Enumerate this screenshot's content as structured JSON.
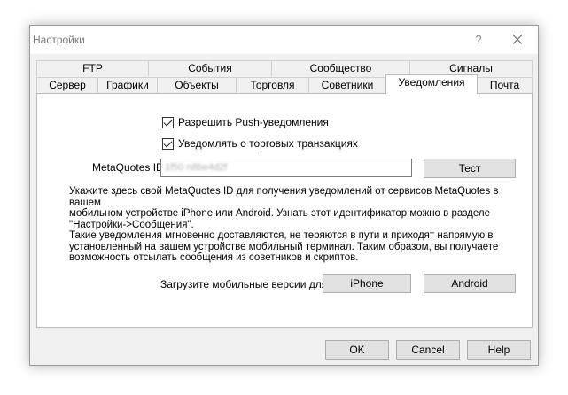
{
  "window": {
    "title": "Настройки",
    "help_glyph": "?"
  },
  "tabs_row1": [
    "FTP",
    "События",
    "Сообщество",
    "Сигналы"
  ],
  "tabs_row2": [
    "Сервер",
    "Графики",
    "Объекты",
    "Торговля",
    "Советники",
    "Уведомления",
    "Почта"
  ],
  "active_tab": "Уведомления",
  "checkboxes": {
    "push": {
      "label": "Разрешить Push-уведомления",
      "checked": true
    },
    "transactions": {
      "label": "Уведомлять о торговых транзакциях",
      "checked": true
    }
  },
  "metaquotes": {
    "label": "MetaQuotes ID:",
    "value": "1f50 n8be4d2f",
    "test_button": "Тест"
  },
  "info": {
    "line1": "Укажите здесь свой MetaQuotes ID для получения уведомлений от сервисов MetaQuotes в вашем",
    "line2": "мобильном устройстве iPhone или Android. Узнать этот идентификатор можно в разделе",
    "line3": "\"Настройки->Сообщения\".",
    "line4": "Такие уведомления мгновенно доставляются, не теряются в пути и приходят напрямую в",
    "line5": "установленный на вашем устройстве мобильный терминал. Таким образом, вы получаете",
    "line6": "возможность отсылать сообщения из советников и скриптов."
  },
  "download": {
    "label": "Загрузите мобильные версии для:",
    "iphone": "iPhone",
    "android": "Android"
  },
  "footer": {
    "ok": "OK",
    "cancel": "Cancel",
    "help": "Help"
  }
}
